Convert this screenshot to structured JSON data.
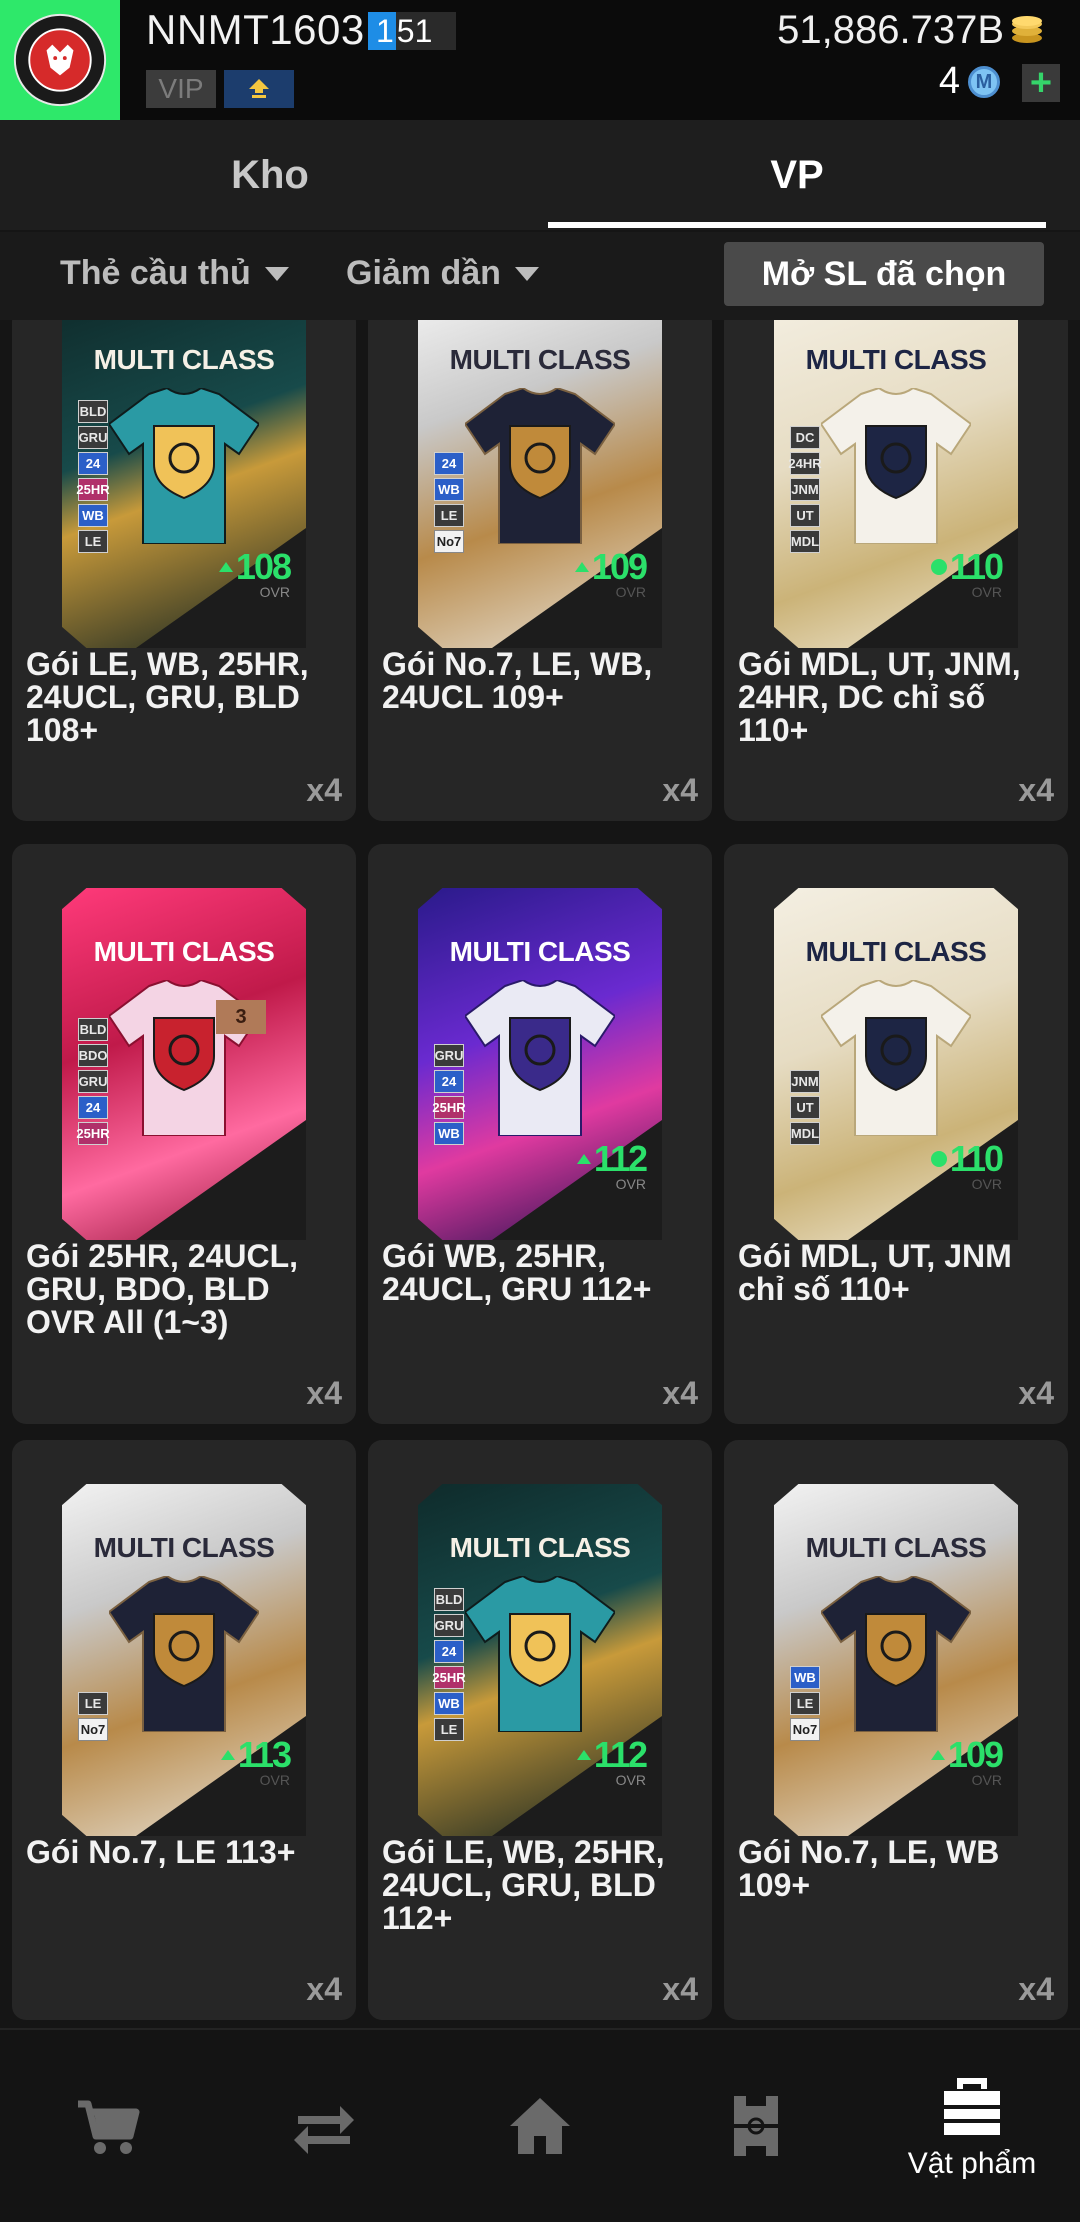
{
  "header": {
    "club_logo": "fc-midtjylland-crest",
    "username": "NNMT1603",
    "level": "151",
    "level_fill_digit": "1",
    "level_rest": "51",
    "vip_label": "VIP",
    "rank_icon": "rank-up-icon",
    "bp_value": "51,886.737B",
    "fc_count": "4",
    "fc_icon_letter": "M",
    "add_label": "+"
  },
  "tabs": [
    {
      "label": "Kho",
      "active": false
    },
    {
      "label": "VP",
      "active": true
    }
  ],
  "filters": {
    "type_label": "Thẻ cầu thủ",
    "sort_label": "Giảm dần",
    "open_selected_label": "Mở SL đã chọn"
  },
  "items": [
    {
      "name": "Gói LE, WB, 25HR, 24UCL, GRU, BLD 108+",
      "qty": "x4",
      "card_label": "MULTI CLASS",
      "ovr": "108",
      "ovr_label": "OVR",
      "chips": [
        "BLD",
        "GRU",
        "24",
        "25HR",
        "WB",
        "LE"
      ],
      "theme": "teal"
    },
    {
      "name": "Gói No.7, LE, WB, 24UCL 109+",
      "qty": "x4",
      "card_label": "MULTI CLASS",
      "ovr": "109",
      "ovr_label": "OVR",
      "chips": [
        "24",
        "WB",
        "LE",
        "No7"
      ],
      "theme": "no7"
    },
    {
      "name": "Gói MDL, UT, JNM, 24HR, DC chỉ số 110+",
      "qty": "x4",
      "card_label": "MULTI CLASS",
      "ovr": "110",
      "ovr_label": "OVR",
      "chips": [
        "DC",
        "24HR",
        "JNM",
        "UT",
        "MDL"
      ],
      "theme": "medalist"
    },
    {
      "name": "Gói 25HR, 24UCL, GRU, BDO, BLD OVR All (1~3)",
      "qty": "x4",
      "card_label": "MULTI CLASS",
      "ovr": "",
      "ovr_label": "",
      "rank": "3",
      "chips": [
        "BLD",
        "BDO",
        "GRU",
        "24",
        "25HR"
      ],
      "theme": "pink"
    },
    {
      "name": "Gói WB, 25HR, 24UCL, GRU 112+",
      "qty": "x4",
      "card_label": "MULTI CLASS",
      "ovr": "112",
      "ovr_label": "OVR",
      "chips": [
        "GRU",
        "24",
        "25HR",
        "WB"
      ],
      "theme": "purple"
    },
    {
      "name": "Gói MDL, UT, JNM chỉ số 110+",
      "qty": "x4",
      "card_label": "MULTI CLASS",
      "ovr": "110",
      "ovr_label": "OVR",
      "chips": [
        "JNM",
        "UT",
        "MDL"
      ],
      "theme": "medalist"
    },
    {
      "name": "Gói No.7, LE 113+",
      "qty": "x4",
      "card_label": "MULTI CLASS",
      "ovr": "113",
      "ovr_label": "OVR",
      "chips": [
        "LE",
        "No7"
      ],
      "theme": "no7"
    },
    {
      "name": "Gói LE, WB, 25HR, 24UCL, GRU, BLD 112+",
      "qty": "x4",
      "card_label": "MULTI CLASS",
      "ovr": "112",
      "ovr_label": "OVR",
      "chips": [
        "BLD",
        "GRU",
        "24",
        "25HR",
        "WB",
        "LE"
      ],
      "theme": "teal"
    },
    {
      "name": "Gói No.7, LE, WB 109+",
      "qty": "x4",
      "card_label": "MULTI CLASS",
      "ovr": "109",
      "ovr_label": "OVR",
      "chips": [
        "WB",
        "LE",
        "No7"
      ],
      "theme": "no7"
    }
  ],
  "bottom_nav": [
    {
      "icon": "cart-icon",
      "label": "",
      "active": false
    },
    {
      "icon": "transfer-icon",
      "label": "",
      "active": false
    },
    {
      "icon": "home-icon",
      "label": "",
      "active": false
    },
    {
      "icon": "pitch-icon",
      "label": "",
      "active": false
    },
    {
      "icon": "bag-icon",
      "label": "Vật phẩm",
      "active": true
    }
  ],
  "colors": {
    "background": "#151515",
    "tile": "#262626",
    "accent_green": "#2be06a",
    "level_blue": "#1e8de6",
    "club_green": "#2ee86a"
  }
}
